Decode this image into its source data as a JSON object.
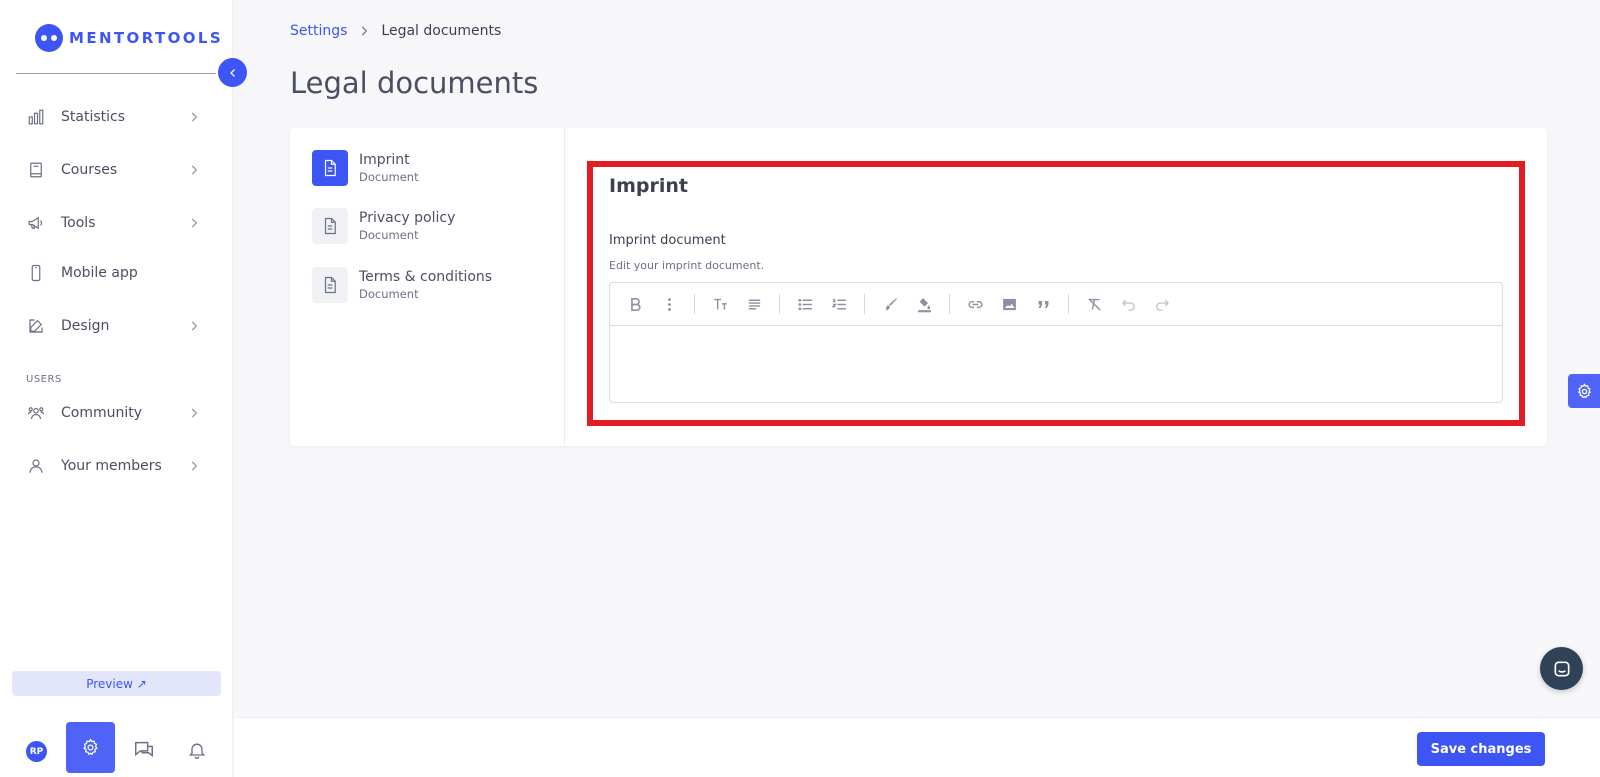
{
  "brand": {
    "name": "MENTORTOOLS",
    "color": "#3d55f4"
  },
  "sidebar": {
    "items": [
      {
        "label": "Statistics",
        "icon": "bar-chart-icon",
        "has_chevron": true
      },
      {
        "label": "Courses",
        "icon": "book-icon",
        "has_chevron": true
      },
      {
        "label": "Tools",
        "icon": "megaphone-icon",
        "has_chevron": true
      },
      {
        "label": "Mobile app",
        "icon": "phone-icon",
        "has_chevron": false
      },
      {
        "label": "Design",
        "icon": "pencil-square-icon",
        "has_chevron": true
      }
    ],
    "section_label": "USERS",
    "user_items": [
      {
        "label": "Community",
        "icon": "people-icon",
        "has_chevron": true
      },
      {
        "label": "Your members",
        "icon": "person-icon",
        "has_chevron": true
      }
    ],
    "preview_label": "Preview ↗",
    "avatar_initials": "RP"
  },
  "breadcrumb": {
    "parent": "Settings",
    "current": "Legal documents"
  },
  "page_title": "Legal documents",
  "documents": [
    {
      "name": "Imprint",
      "type": "Document",
      "active": true
    },
    {
      "name": "Privacy policy",
      "type": "Document",
      "active": false
    },
    {
      "name": "Terms & conditions",
      "type": "Document",
      "active": false
    }
  ],
  "editor": {
    "title": "Imprint",
    "field_label": "Imprint document",
    "field_help": "Edit your imprint document.",
    "content": "",
    "toolbar": [
      "bold",
      "more-vertical",
      "font-size",
      "align",
      "bullet-list",
      "numbered-list",
      "brush",
      "fill-color",
      "link",
      "image",
      "quote",
      "clear-format",
      "undo",
      "redo"
    ]
  },
  "footer": {
    "save_label": "Save changes"
  },
  "colors": {
    "accent": "#3d55f4",
    "highlight": "#e31b23",
    "chat": "#2f4257"
  }
}
